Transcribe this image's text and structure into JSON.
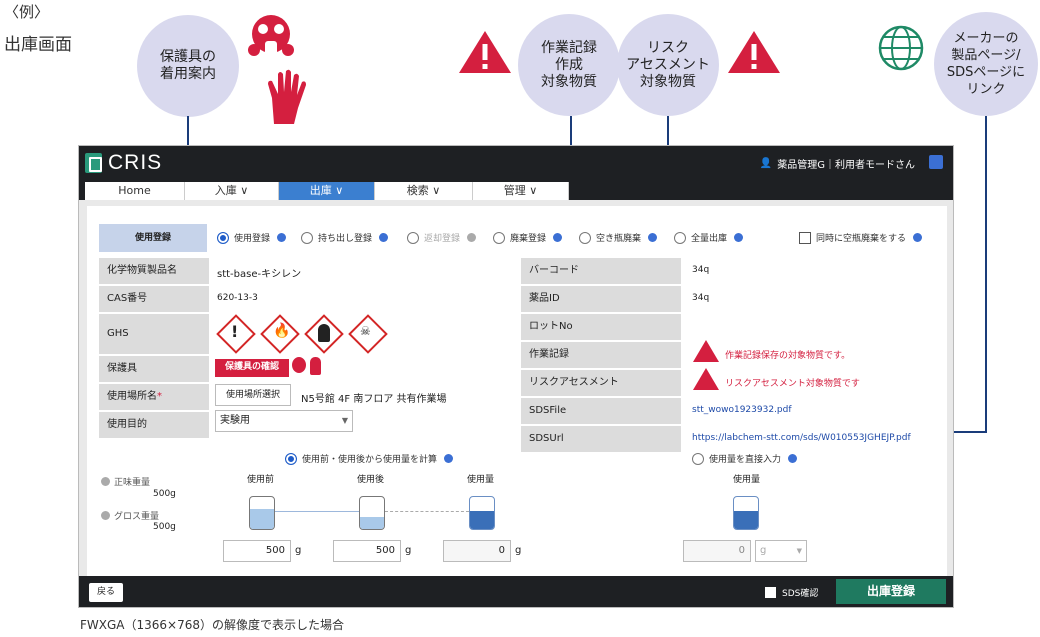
{
  "annotations": {
    "example_label": "〈例〉",
    "example_title": "出庫画面",
    "bubble_ppe": "保護具の\n着用案内",
    "bubble_work_record": "作業記録\n作成\n対象物質",
    "bubble_risk": "リスク\nアセスメント\n対象物質",
    "bubble_maker_link": "メーカーの\n製品ページ/\nSDSページに\nリンク",
    "caption": "FWXGA（1366×768）の解像度で表示した場合"
  },
  "app": {
    "logo": "CRIS",
    "user": "薬品管理G｜利用者モードさん",
    "tabs": [
      "Home",
      "入庫 ∨",
      "出庫 ∨",
      "検索 ∨",
      "管理 ∨"
    ],
    "usage_section_label": "使用登録",
    "usage_options": [
      "使用登録",
      "持ち出し登録",
      "返却登録",
      "廃棄登録",
      "空き瓶廃棄",
      "全量出庫"
    ],
    "simultaneous_disposal": "同時に空瓶廃棄をする",
    "left_rows": {
      "chemical_name_label": "化学物質製品名",
      "chemical_name_value": "stt-base-キシレン",
      "cas_label": "CAS番号",
      "cas_value": "620-13-3",
      "ghs_label": "GHS",
      "ppe_label": "保護具",
      "ppe_badge": "保護具の確認",
      "location_label": "使用場所名",
      "location_button": "使用場所選択",
      "location_value": "N5号館 4F 南フロア 共有作業場",
      "purpose_label": "使用目的",
      "purpose_value": "実験用"
    },
    "right_rows": {
      "barcode_label": "バーコード",
      "barcode_value": "34q",
      "drug_id_label": "薬品ID",
      "drug_id_value": "34q",
      "lot_label": "ロットNo",
      "lot_value": "",
      "work_record_label": "作業記録",
      "work_record_value": "作業記録保存の対象物質です。",
      "risk_label": "リスクアセスメント",
      "risk_value": "リスクアセスメント対象物質です",
      "sds_file_label": "SDSFile",
      "sds_file_value": "stt_wowo1923932.pdf",
      "sds_url_label": "SDSUrl",
      "sds_url_value": "https://labchem-stt.com/sds/W010553JGHEJP.pdf"
    },
    "calc": {
      "mode_before_after": "使用前・使用後から使用量を計算",
      "mode_direct": "使用量を直接入力",
      "net_weight_label": "正味重量",
      "net_weight_value": "500g",
      "gross_weight_label": "グロス重量",
      "gross_weight_value": "500g",
      "col_before": "使用前",
      "col_after": "使用後",
      "col_amount": "使用量",
      "col_amount_direct": "使用量",
      "before_value": "500",
      "after_value": "500",
      "amount_value": "0",
      "direct_value": "0",
      "unit": "g"
    },
    "footer": {
      "back": "戻る",
      "sds_confirm": "SDS確認",
      "submit": "出庫登録"
    }
  }
}
